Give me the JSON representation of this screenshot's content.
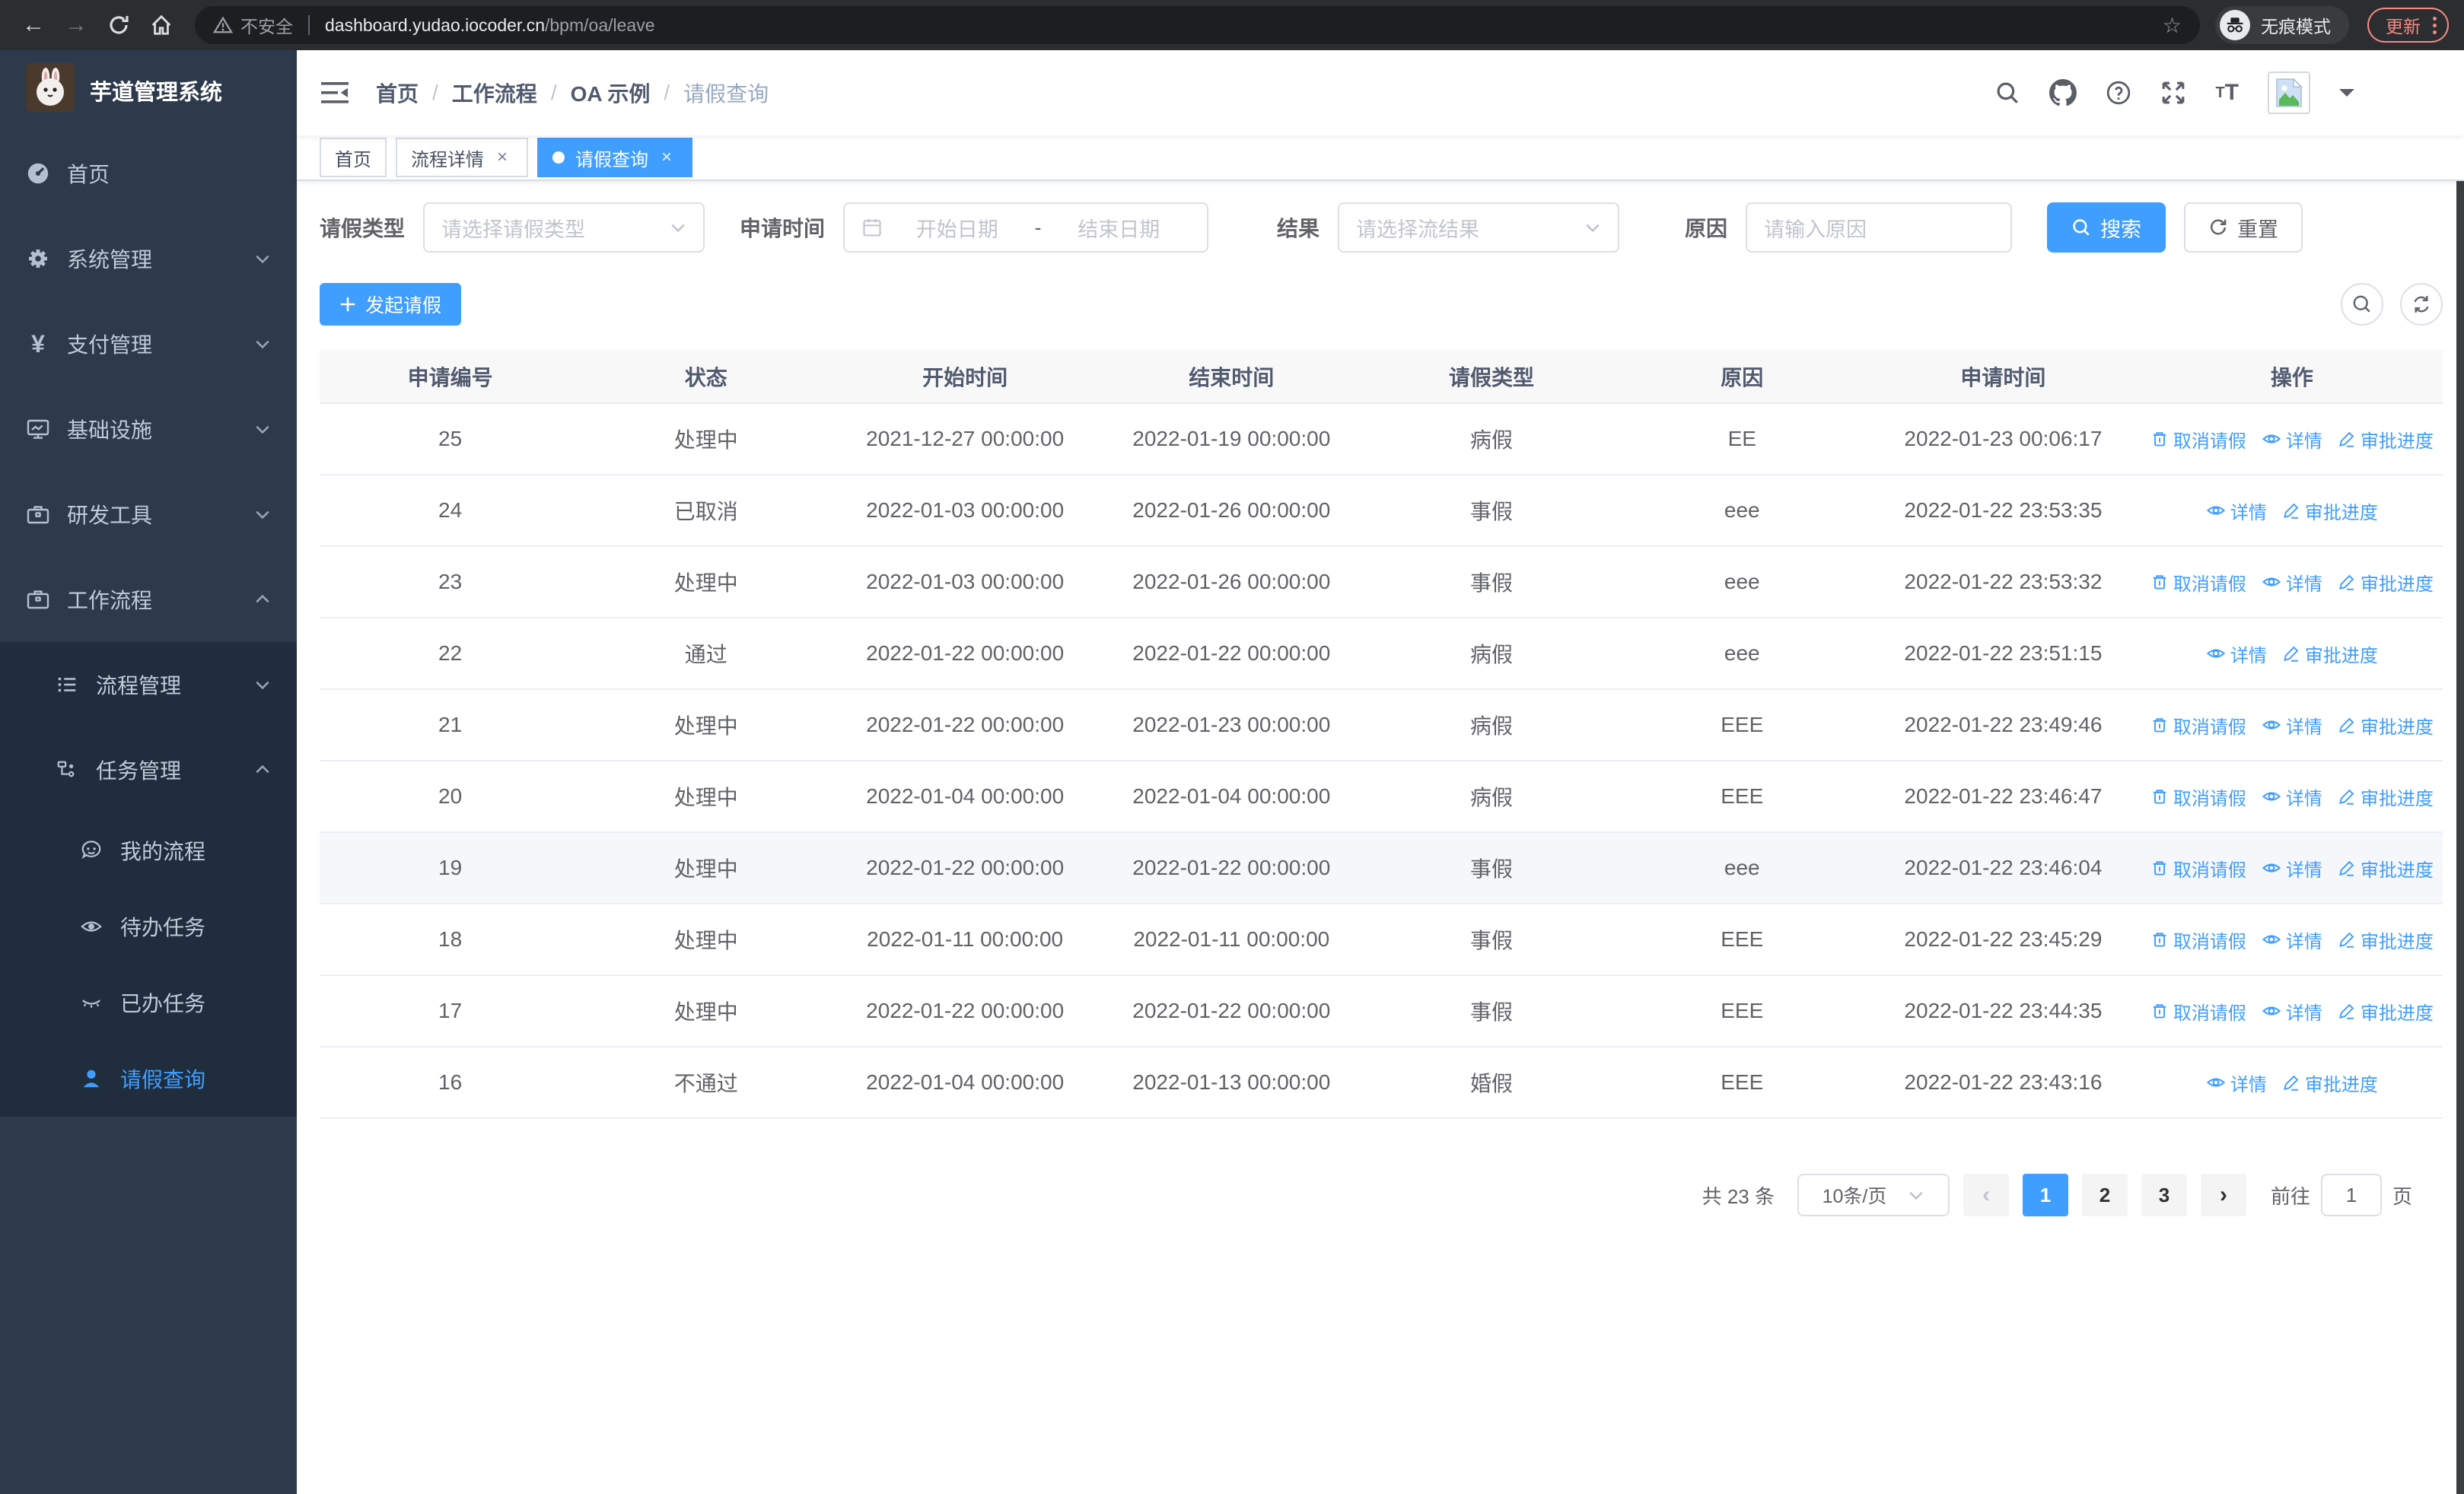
{
  "browser": {
    "security_label": "不安全",
    "url_host": "dashboard.yudao.iocoder.cn",
    "url_path": "/bpm/oa/leave",
    "incognito_label": "无痕模式",
    "update_label": "更新"
  },
  "sidebar": {
    "title": "芋道管理系统",
    "items": [
      {
        "label": "首页",
        "icon": "dashboard-icon",
        "level": 1
      },
      {
        "label": "系统管理",
        "icon": "gear-icon",
        "level": 1,
        "expandable": true
      },
      {
        "label": "支付管理",
        "icon": "yen-icon",
        "level": 1,
        "expandable": true
      },
      {
        "label": "基础设施",
        "icon": "monitor-icon",
        "level": 1,
        "expandable": true
      },
      {
        "label": "研发工具",
        "icon": "toolbox-icon",
        "level": 1,
        "expandable": true
      },
      {
        "label": "工作流程",
        "icon": "briefcase-icon",
        "level": 1,
        "expandable": true,
        "expanded": true
      },
      {
        "label": "流程管理",
        "icon": "list-icon",
        "level": 2,
        "expandable": true
      },
      {
        "label": "任务管理",
        "icon": "tree-icon",
        "level": 2,
        "expandable": true,
        "expanded": true
      },
      {
        "label": "我的流程",
        "icon": "face-icon",
        "level": 3
      },
      {
        "label": "待办任务",
        "icon": "eye-open-icon",
        "level": 3
      },
      {
        "label": "已办任务",
        "icon": "eye-closed-icon",
        "level": 3
      },
      {
        "label": "请假查询",
        "icon": "user-icon",
        "level": 3,
        "active": true
      }
    ]
  },
  "breadcrumb": [
    "首页",
    "工作流程",
    "OA 示例",
    "请假查询"
  ],
  "tabs": [
    {
      "label": "首页",
      "active": false,
      "closable": false
    },
    {
      "label": "流程详情",
      "active": false,
      "closable": true
    },
    {
      "label": "请假查询",
      "active": true,
      "closable": true
    }
  ],
  "filters": {
    "leave_type": {
      "label": "请假类型",
      "placeholder": "请选择请假类型"
    },
    "apply_time": {
      "label": "申请时间",
      "start_placeholder": "开始日期",
      "separator": "-",
      "end_placeholder": "结束日期"
    },
    "result": {
      "label": "结果",
      "placeholder": "请选择流结果"
    },
    "reason": {
      "label": "原因",
      "placeholder": "请输入原因"
    },
    "search_label": "搜索",
    "reset_label": "重置"
  },
  "toolbar": {
    "create_label": "发起请假"
  },
  "table": {
    "headers": [
      "申请编号",
      "状态",
      "开始时间",
      "结束时间",
      "请假类型",
      "原因",
      "申请时间",
      "操作"
    ],
    "action_labels": {
      "cancel": "取消请假",
      "detail": "详情",
      "progress": "审批进度"
    },
    "rows": [
      {
        "id": "25",
        "status": "处理中",
        "start": "2021-12-27 00:00:00",
        "end": "2022-01-19 00:00:00",
        "type": "病假",
        "reason": "EE",
        "apply": "2022-01-23 00:06:17",
        "actions": [
          "cancel",
          "detail",
          "progress"
        ],
        "highlight": false
      },
      {
        "id": "24",
        "status": "已取消",
        "start": "2022-01-03 00:00:00",
        "end": "2022-01-26 00:00:00",
        "type": "事假",
        "reason": "eee",
        "apply": "2022-01-22 23:53:35",
        "actions": [
          "detail",
          "progress"
        ],
        "highlight": false
      },
      {
        "id": "23",
        "status": "处理中",
        "start": "2022-01-03 00:00:00",
        "end": "2022-01-26 00:00:00",
        "type": "事假",
        "reason": "eee",
        "apply": "2022-01-22 23:53:32",
        "actions": [
          "cancel",
          "detail",
          "progress"
        ],
        "highlight": false
      },
      {
        "id": "22",
        "status": "通过",
        "start": "2022-01-22 00:00:00",
        "end": "2022-01-22 00:00:00",
        "type": "病假",
        "reason": "eee",
        "apply": "2022-01-22 23:51:15",
        "actions": [
          "detail",
          "progress"
        ],
        "highlight": false
      },
      {
        "id": "21",
        "status": "处理中",
        "start": "2022-01-22 00:00:00",
        "end": "2022-01-23 00:00:00",
        "type": "病假",
        "reason": "EEE",
        "apply": "2022-01-22 23:49:46",
        "actions": [
          "cancel",
          "detail",
          "progress"
        ],
        "highlight": false
      },
      {
        "id": "20",
        "status": "处理中",
        "start": "2022-01-04 00:00:00",
        "end": "2022-01-04 00:00:00",
        "type": "病假",
        "reason": "EEE",
        "apply": "2022-01-22 23:46:47",
        "actions": [
          "cancel",
          "detail",
          "progress"
        ],
        "highlight": false
      },
      {
        "id": "19",
        "status": "处理中",
        "start": "2022-01-22 00:00:00",
        "end": "2022-01-22 00:00:00",
        "type": "事假",
        "reason": "eee",
        "apply": "2022-01-22 23:46:04",
        "actions": [
          "cancel",
          "detail",
          "progress"
        ],
        "highlight": true
      },
      {
        "id": "18",
        "status": "处理中",
        "start": "2022-01-11 00:00:00",
        "end": "2022-01-11 00:00:00",
        "type": "事假",
        "reason": "EEE",
        "apply": "2022-01-22 23:45:29",
        "actions": [
          "cancel",
          "detail",
          "progress"
        ],
        "highlight": false
      },
      {
        "id": "17",
        "status": "处理中",
        "start": "2022-01-22 00:00:00",
        "end": "2022-01-22 00:00:00",
        "type": "事假",
        "reason": "EEE",
        "apply": "2022-01-22 23:44:35",
        "actions": [
          "cancel",
          "detail",
          "progress"
        ],
        "highlight": false
      },
      {
        "id": "16",
        "status": "不通过",
        "start": "2022-01-04 00:00:00",
        "end": "2022-01-13 00:00:00",
        "type": "婚假",
        "reason": "EEE",
        "apply": "2022-01-22 23:43:16",
        "actions": [
          "detail",
          "progress"
        ],
        "highlight": false
      }
    ]
  },
  "pagination": {
    "total_label": "共 23 条",
    "page_size_label": "10条/页",
    "pages": [
      "1",
      "2",
      "3"
    ],
    "active_page": "1",
    "goto_label": "前往",
    "goto_value": "1",
    "page_unit": "页"
  },
  "colors": {
    "accent": "#409eff",
    "sidebar_bg": "#2d3a4b",
    "submenu_bg": "#1f2d3d",
    "sidebar_text": "#bfcbd9",
    "table_header_bg": "#f8f8f9",
    "table_border": "#ebeef5",
    "row_hover": "#f5f7fa",
    "update_accent": "#f28b82"
  },
  "icons": [
    "back-icon",
    "forward-icon",
    "reload-icon",
    "home-icon",
    "warning-icon",
    "star-icon",
    "incognito-icon",
    "more-dots-icon",
    "hamburger-icon",
    "search-icon",
    "github-icon",
    "help-icon",
    "fullscreen-icon",
    "font-size-icon",
    "avatar-image",
    "chevron-down-icon",
    "calendar-icon",
    "refresh-icon",
    "plus-icon",
    "trash-icon",
    "eye-icon",
    "pen-icon"
  ]
}
